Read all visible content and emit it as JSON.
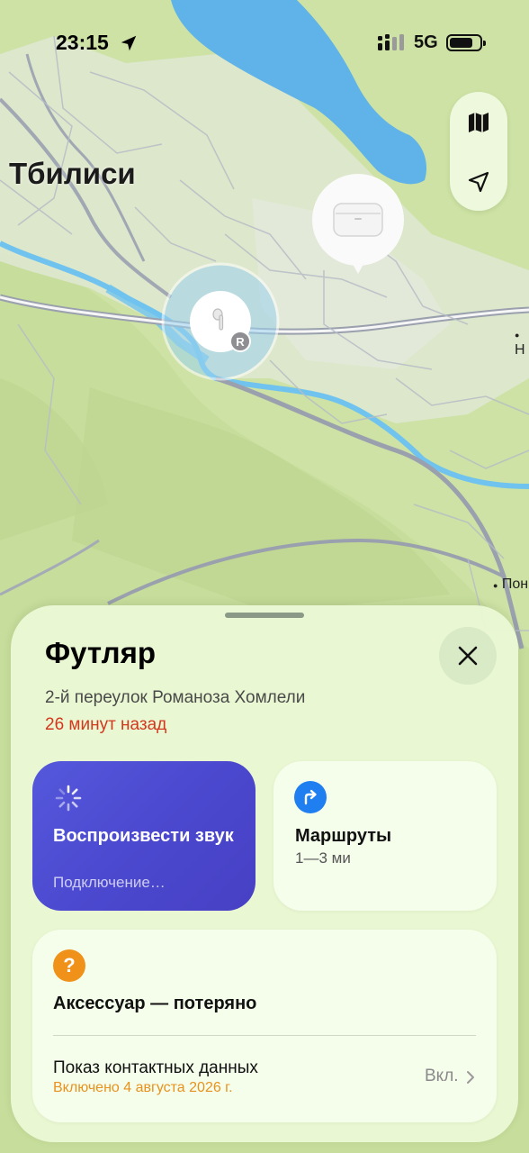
{
  "status_bar": {
    "time": "23:15",
    "network": "5G"
  },
  "map": {
    "city_label": "Тбилиси",
    "poi_labels": [
      "Н",
      "Пон"
    ],
    "pin_badge": "R"
  },
  "sheet": {
    "title": "Футляр",
    "address": "2-й переулок Романоза Хомлели",
    "time_ago": "26 минут назад",
    "play_sound": {
      "label": "Воспроизвести звук",
      "status": "Подключение…"
    },
    "routes": {
      "label": "Маршруты",
      "distance": "1—3 ми"
    },
    "lost_mode": {
      "label": "Аксессуар — потеряно",
      "contact_label": "Показ контактных данных",
      "contact_sub": "Включено 4 августа 2026 г.",
      "contact_value": "Вкл."
    }
  },
  "colors": {
    "accent_blue": "#1f7ff0",
    "alert_red": "#d3381e",
    "warning_orange": "#f0921a",
    "sound_card": "#4b49cf"
  },
  "icons": [
    "location-arrow-icon",
    "signal-icon",
    "battery-icon",
    "map-icon",
    "navigation-arrow-icon",
    "airpods-case-icon",
    "airpod-icon",
    "close-icon",
    "spinner-icon",
    "turn-right-icon",
    "question-icon",
    "chevron-right-icon"
  ]
}
